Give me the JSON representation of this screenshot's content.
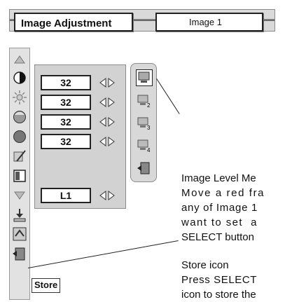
{
  "header": {
    "title": "Image Adjustment",
    "image_value": "Image 1"
  },
  "menu_values": [
    "32",
    "32",
    "32",
    "32",
    "L1"
  ],
  "image_level_icons": [
    "image-1-icon",
    "image-2-icon",
    "image-3-icon",
    "image-4-icon",
    "exit-icon"
  ],
  "left_icons": [
    "up-arrow-icon",
    "contrast-icon",
    "brightness-icon",
    "color-icon",
    "tint-icon",
    "sharpness-icon",
    "gamma-icon",
    "down-arrow-icon",
    "store-icon",
    "reset-icon",
    "quit-icon"
  ],
  "tooltip": {
    "store": "Store"
  },
  "callouts": {
    "image_level": [
      "Image Level Me",
      "Move a red fra",
      "any of Image 1",
      "want to set  a",
      "SELECT button"
    ],
    "store": [
      "Store icon",
      "Press SELECT",
      "icon to store the"
    ]
  },
  "colors": {
    "panel": "#d2d2d2",
    "frame": "#222222",
    "background": "#ffffff"
  }
}
